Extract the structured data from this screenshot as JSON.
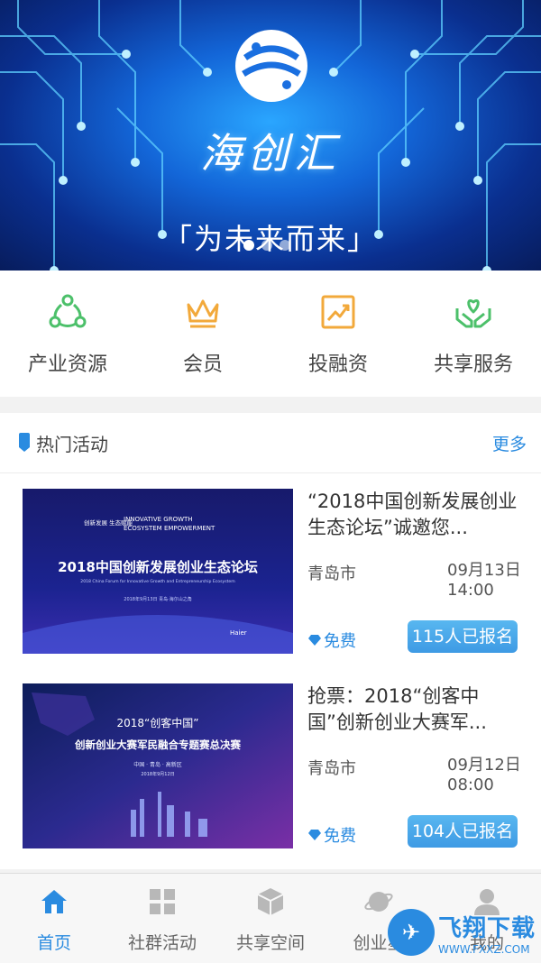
{
  "banner": {
    "brand": "海创汇",
    "slogan": "「为未来而来」",
    "carousel_count": 3,
    "active_index": 0
  },
  "quick_links": [
    {
      "label": "产业资源",
      "icon": "network-icon",
      "color": "#4cc06a"
    },
    {
      "label": "会员",
      "icon": "crown-icon",
      "color": "#f2a93b"
    },
    {
      "label": "投融资",
      "icon": "growth-chart-icon",
      "color": "#f2a93b"
    },
    {
      "label": "共享服务",
      "icon": "heart-hands-icon",
      "color": "#4cc06a"
    }
  ],
  "hot_events": {
    "title": "热门活动",
    "more": "更多",
    "events": [
      {
        "title": "“2018中国创新发展创业生态论坛”诚邀您...",
        "city": "青岛市",
        "date": "09月13日",
        "time": "14:00",
        "price": "免费",
        "signup": "115人已报名",
        "poster": {
          "head_cn": "创新发展 生态赋能",
          "head_en_1": "INNOVATIVE GROWTH",
          "head_en_2": "ECOSYSTEM EMPOWERMENT",
          "main": "2018中国创新发展创业生态论坛",
          "sub": "2018 China Forum for Innovative Growth and Entrepreneurship Ecosystem",
          "date": "2018年9月13日   青岛·海尔山之角",
          "sponsors": "Haier"
        }
      },
      {
        "title": "抢票：2018“创客中国”创新创业大赛军...",
        "city": "青岛市",
        "date": "09月12日",
        "time": "08:00",
        "price": "免费",
        "signup": "104人已报名",
        "poster": {
          "main_1": "2018“创客中国”",
          "main_2": "创新创业大赛军民融合专题赛总决赛",
          "place": "中国 · 青岛 · 高新区",
          "date": "2018年9月12日"
        }
      }
    ]
  },
  "tabbar": [
    {
      "label": "首页",
      "icon": "home-icon",
      "active": true
    },
    {
      "label": "社群活动",
      "icon": "grid-icon",
      "active": false
    },
    {
      "label": "共享空间",
      "icon": "cube-icon",
      "active": false
    },
    {
      "label": "创业星",
      "icon": "planet-icon",
      "active": false
    },
    {
      "label": "我的",
      "icon": "user-icon",
      "active": false
    }
  ],
  "watermark": {
    "main": "飞翔下载",
    "sub": "WWW.FXXZ.COM"
  },
  "colors": {
    "accent": "#2a8be0",
    "green": "#4cc06a",
    "orange": "#f2a93b"
  }
}
